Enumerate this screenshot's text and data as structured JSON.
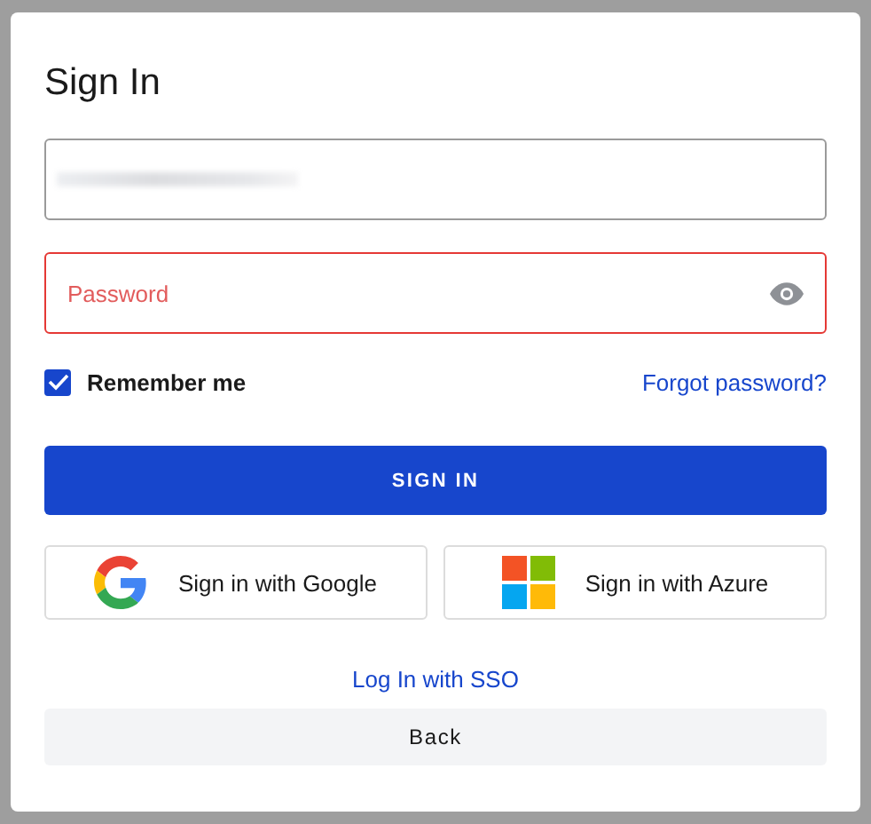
{
  "dialog": {
    "title": "Sign In"
  },
  "username_field": {
    "redacted": true,
    "error": false
  },
  "password_field": {
    "placeholder": "Password",
    "error": true
  },
  "remember_me": {
    "label": "Remember me",
    "checked": true
  },
  "forgot_password_link": "Forgot password?",
  "sign_in_button": "SIGN IN",
  "social_buttons": [
    {
      "kind": "google",
      "label": "Sign in with Google"
    },
    {
      "kind": "azure",
      "label": "Sign in with Azure"
    }
  ],
  "sso_link": "Log In with SSO",
  "back_button": "Back"
}
